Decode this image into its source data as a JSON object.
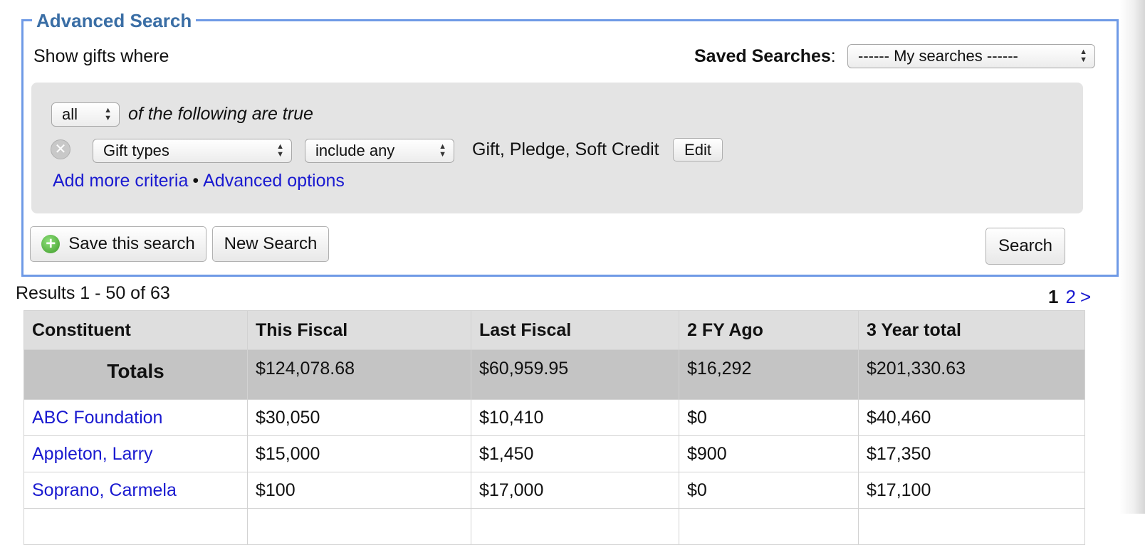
{
  "advanced_search": {
    "legend": "Advanced Search",
    "show_where": "Show gifts where",
    "saved_searches_label": "Saved Searches",
    "saved_searches_colon": ":",
    "saved_searches_value": "------ My searches ------",
    "match_value": "all",
    "match_suffix": "of the following are true",
    "criteria": {
      "remove_icon": "✕",
      "field": "Gift types",
      "operator": "include any",
      "values": "Gift, Pledge, Soft Credit",
      "edit_label": "Edit"
    },
    "add_more_criteria": "Add more criteria",
    "link_separator": "•",
    "advanced_options": "Advanced options",
    "save_search_label": "Save this search",
    "plus_icon": "+",
    "new_search_label": "New Search",
    "search_label": "Search"
  },
  "results": {
    "count_text": "Results 1 - 50 of 63",
    "pagination": {
      "current": "1",
      "next_page": "2",
      "next_arrow": ">"
    }
  },
  "table": {
    "columns": [
      "Constituent",
      "This Fiscal",
      "Last Fiscal",
      "2 FY Ago",
      "3 Year total"
    ],
    "totals": [
      "Totals",
      "$124,078.68",
      "$60,959.95",
      "$16,292",
      "$201,330.63"
    ],
    "rows": [
      [
        "ABC Foundation",
        "$30,050",
        "$10,410",
        "$0",
        "$40,460"
      ],
      [
        "Appleton, Larry",
        "$15,000",
        "$1,450",
        "$900",
        "$17,350"
      ],
      [
        "Soprano, Carmela",
        "$100",
        "$17,000",
        "$0",
        "$17,100"
      ],
      [
        "",
        "",
        "",
        "",
        ""
      ]
    ]
  },
  "colors": {
    "fieldset_border": "#6f9ae6",
    "legend_text": "#3a6ea5",
    "link": "#1a1ad0",
    "panel_bg": "#e4e4e4",
    "header_bg": "#dedede",
    "totals_bg": "#c4c4c4"
  }
}
